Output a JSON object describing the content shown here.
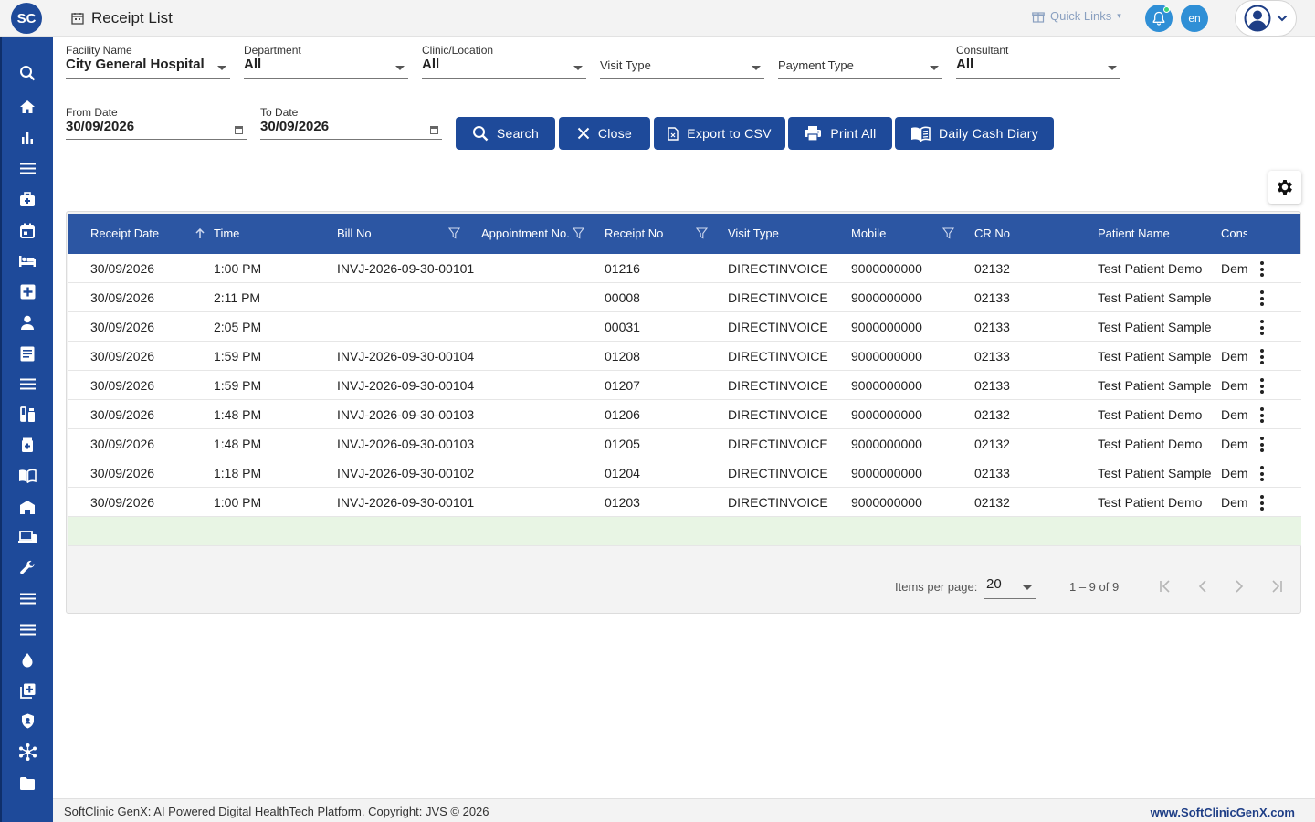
{
  "header": {
    "logo_text": "SC",
    "page_title": "Receipt List",
    "quick_links": "Quick Links",
    "language": "en"
  },
  "sidebar": {
    "icons": [
      "search-icon",
      "home-icon",
      "bar-chart-icon",
      "menu-icon",
      "medical-bag-icon",
      "calendar-icon",
      "bed-icon",
      "plus-square-icon",
      "person-icon",
      "document-icon",
      "list-icon",
      "lab-icon",
      "pharmacy-icon",
      "book-icon",
      "building-icon",
      "devices-icon",
      "wrench-icon",
      "list-icon",
      "list-icon",
      "drop-icon",
      "add-box-icon",
      "shield-icon",
      "network-icon",
      "folder-icon"
    ]
  },
  "filters": {
    "facility": {
      "label": "Facility Name",
      "value": "City General Hospital"
    },
    "department": {
      "label": "Department",
      "value": "All"
    },
    "clinic": {
      "label": "Clinic/Location",
      "value": "All"
    },
    "visit_type": {
      "placeholder": "Visit Type"
    },
    "payment_type": {
      "placeholder": "Payment Type"
    },
    "consultant": {
      "label": "Consultant",
      "value": "All"
    },
    "from_date": {
      "label": "From Date",
      "value": "30/09/2026"
    },
    "to_date": {
      "label": "To Date",
      "value": "30/09/2026"
    }
  },
  "buttons": {
    "search": "Search",
    "close": "Close",
    "export_csv": "Export to CSV",
    "print_all": "Print All",
    "daily_cash_diary": "Daily Cash Diary"
  },
  "table": {
    "columns": [
      "Receipt Date",
      "Time",
      "Bill No",
      "Appointment No.",
      "Receipt No",
      "Visit Type",
      "Mobile",
      "CR No",
      "Patient Name",
      "Cons"
    ],
    "rows": [
      [
        "30/09/2026",
        "1:00 PM",
        "INVJ-2026-09-30-00101",
        "",
        "01216",
        "DIRECTINVOICE",
        "9000000000",
        "02132",
        "Test Patient Demo",
        "Dem"
      ],
      [
        "30/09/2026",
        "2:11 PM",
        "",
        "",
        "00008",
        "DIRECTINVOICE",
        "9000000000",
        "02133",
        "Test Patient Sample",
        ""
      ],
      [
        "30/09/2026",
        "2:05 PM",
        "",
        "",
        "00031",
        "DIRECTINVOICE",
        "9000000000",
        "02133",
        "Test Patient Sample",
        ""
      ],
      [
        "30/09/2026",
        "1:59 PM",
        "INVJ-2026-09-30-00104",
        "",
        "01208",
        "DIRECTINVOICE",
        "9000000000",
        "02133",
        "Test Patient Sample",
        "Dem"
      ],
      [
        "30/09/2026",
        "1:59 PM",
        "INVJ-2026-09-30-00104",
        "",
        "01207",
        "DIRECTINVOICE",
        "9000000000",
        "02133",
        "Test Patient Sample",
        "Dem"
      ],
      [
        "30/09/2026",
        "1:48 PM",
        "INVJ-2026-09-30-00103",
        "",
        "01206",
        "DIRECTINVOICE",
        "9000000000",
        "02132",
        "Test Patient Demo",
        "Dem"
      ],
      [
        "30/09/2026",
        "1:48 PM",
        "INVJ-2026-09-30-00103",
        "",
        "01205",
        "DIRECTINVOICE",
        "9000000000",
        "02132",
        "Test Patient Demo",
        "Dem"
      ],
      [
        "30/09/2026",
        "1:18 PM",
        "INVJ-2026-09-30-00102",
        "",
        "01204",
        "DIRECTINVOICE",
        "9000000000",
        "02133",
        "Test Patient Sample",
        "Dem"
      ],
      [
        "30/09/2026",
        "1:00 PM",
        "INVJ-2026-09-30-00101",
        "",
        "01203",
        "DIRECTINVOICE",
        "9000000000",
        "02132",
        "Test Patient Demo",
        "Dem"
      ]
    ]
  },
  "paginator": {
    "items_per_page_label": "Items per page:",
    "items_per_page": "20",
    "range": "1 – 9 of 9"
  },
  "footer": {
    "copyright": "SoftClinic GenX: AI Powered Digital HealthTech Platform. Copyright: JVS © 2026",
    "website": "www.SoftClinicGenX.com"
  },
  "colors": {
    "primary": "#1e4a9a",
    "table_header": "#2c56a3",
    "empty_row": "#e8f5e4"
  }
}
